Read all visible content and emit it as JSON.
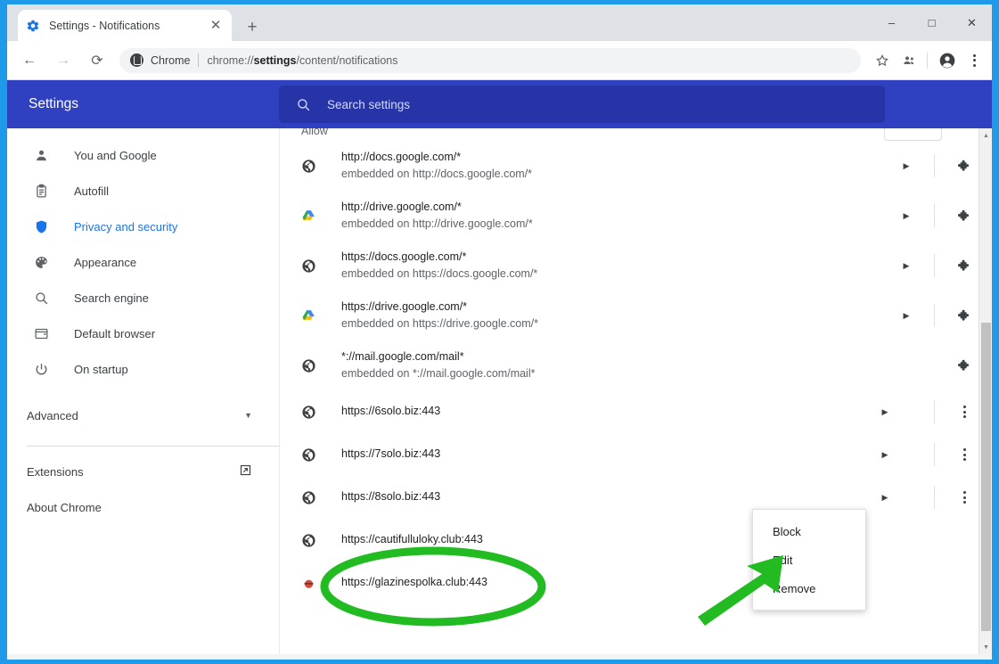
{
  "window": {
    "controls": {
      "minimize": "–",
      "maximize": "□",
      "close": "✕"
    }
  },
  "tab": {
    "title": "Settings - Notifications",
    "favicon": "settings-gear-icon",
    "close_label": "✕",
    "new_tab_label": "+"
  },
  "toolbar": {
    "back_label": "←",
    "forward_label": "→",
    "reload_label": "⟳",
    "secure_icon": "chrome-page-icon",
    "scheme_label": "Chrome",
    "url_prefix": "chrome://",
    "url_bold": "settings",
    "url_suffix": "/content/notifications",
    "bookmark_icon": "star-icon",
    "people_icon": "people-icon",
    "profile_icon": "avatar-icon",
    "menu_icon": "three-dot-menu-icon"
  },
  "settings_header": {
    "title": "Settings",
    "search_placeholder": "Search settings",
    "search_value": "",
    "search_icon": "search-icon",
    "bg_color": "#2f40c0"
  },
  "sidebar": {
    "items": [
      {
        "label": "You and Google",
        "icon": "person-icon",
        "active": false
      },
      {
        "label": "Autofill",
        "icon": "clipboard-icon",
        "active": false
      },
      {
        "label": "Privacy and security",
        "icon": "shield-icon",
        "active": true
      },
      {
        "label": "Appearance",
        "icon": "palette-icon",
        "active": false
      },
      {
        "label": "Search engine",
        "icon": "search-icon",
        "active": false
      },
      {
        "label": "Default browser",
        "icon": "browser-window-icon",
        "active": false
      },
      {
        "label": "On startup",
        "icon": "power-icon",
        "active": false
      }
    ],
    "advanced": {
      "label": "Advanced",
      "caret_icon": "chevron-down-icon"
    },
    "links": [
      {
        "label": "Extensions",
        "icon": "external-link-icon"
      },
      {
        "label": "About Chrome",
        "icon": ""
      }
    ]
  },
  "main": {
    "section_label": "Allow",
    "add_button_label": "",
    "sites": [
      {
        "origin": "http://docs.google.com/*",
        "embedded": "embedded on http://docs.google.com/*",
        "favicon": "globe-icon",
        "has_expand": true,
        "has_divider": true,
        "action": "puzzle-piece-icon"
      },
      {
        "origin": "http://drive.google.com/*",
        "embedded": "embedded on http://drive.google.com/*",
        "favicon": "google-drive-icon",
        "has_expand": true,
        "has_divider": true,
        "action": "puzzle-piece-icon"
      },
      {
        "origin": "https://docs.google.com/*",
        "embedded": "embedded on https://docs.google.com/*",
        "favicon": "globe-icon",
        "has_expand": true,
        "has_divider": true,
        "action": "puzzle-piece-icon"
      },
      {
        "origin": "https://drive.google.com/*",
        "embedded": "embedded on https://drive.google.com/*",
        "favicon": "google-drive-icon",
        "has_expand": true,
        "has_divider": true,
        "action": "puzzle-piece-icon"
      },
      {
        "origin": "*://mail.google.com/mail*",
        "embedded": "embedded on *://mail.google.com/mail*",
        "favicon": "globe-icon",
        "has_expand": false,
        "has_divider": false,
        "action": "puzzle-piece-icon"
      },
      {
        "origin": "https://6solo.biz:443",
        "embedded": "",
        "favicon": "globe-icon",
        "has_expand": true,
        "has_divider": true,
        "action": "three-dot-menu-icon"
      },
      {
        "origin": "https://7solo.biz:443",
        "embedded": "",
        "favicon": "globe-icon",
        "has_expand": true,
        "has_divider": true,
        "action": "three-dot-menu-icon"
      },
      {
        "origin": "https://8solo.biz:443",
        "embedded": "",
        "favicon": "globe-icon",
        "has_expand": true,
        "has_divider": true,
        "action": "three-dot-menu-icon"
      },
      {
        "origin": "https://cautifulluloky.club:443",
        "embedded": "",
        "favicon": "globe-icon",
        "has_expand": false,
        "has_divider": false,
        "action": ""
      },
      {
        "origin": "https://glazinespolka.club:443",
        "embedded": "",
        "favicon": "red-site-icon",
        "has_expand": false,
        "has_divider": false,
        "action": ""
      }
    ]
  },
  "context_menu": {
    "items": [
      {
        "label": "Block"
      },
      {
        "label": "Edit"
      },
      {
        "label": "Remove"
      }
    ]
  },
  "annotations": {
    "highlight_color": "#22bb22",
    "ellipse_target": "https://glazinespolka.club:443",
    "arrow_target": "Remove"
  }
}
